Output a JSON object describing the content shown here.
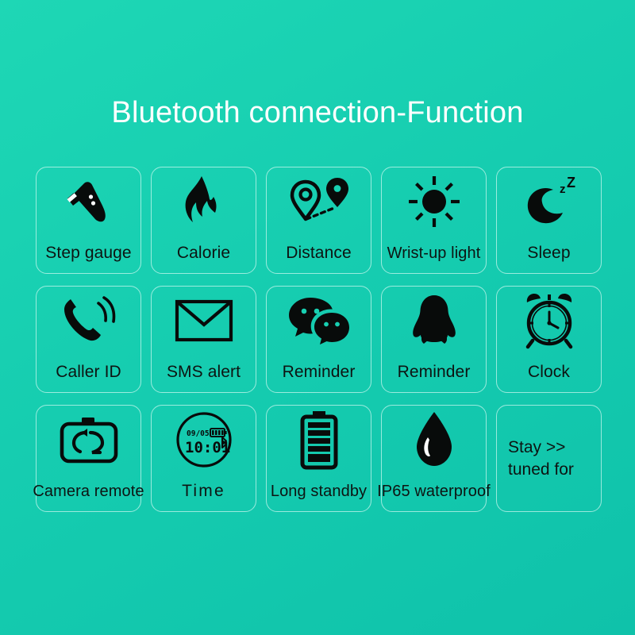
{
  "header": {
    "title": "Bluetooth connection-Function"
  },
  "colors": {
    "background_top": "#1ed7b5",
    "background_bottom": "#0fc2aa",
    "title_text": "#ffffff",
    "label_text": "#0d1412",
    "icon": "#080b0a",
    "card_border": "rgba(235,255,250,0.62)"
  },
  "features": [
    {
      "label": "Step gauge",
      "icon": "shoe-icon"
    },
    {
      "label": "Calorie",
      "icon": "flame-icon"
    },
    {
      "label": "Distance",
      "icon": "map-pins-icon"
    },
    {
      "label": "Wrist-up light",
      "icon": "sun-icon"
    },
    {
      "label": "Sleep",
      "icon": "moon-zz-icon"
    },
    {
      "label": "Caller ID",
      "icon": "ringing-phone-icon"
    },
    {
      "label": "SMS alert",
      "icon": "envelope-icon"
    },
    {
      "label": "Reminder",
      "icon": "wechat-bubbles-icon"
    },
    {
      "label": "Reminder",
      "icon": "qq-penguin-icon"
    },
    {
      "label": "Clock",
      "icon": "alarm-clock-icon"
    },
    {
      "label": "Camera remote",
      "icon": "camera-icon"
    },
    {
      "label": "Time",
      "icon": "watch-face-icon"
    },
    {
      "label": "Long standby",
      "icon": "battery-icon"
    },
    {
      "label": "IP65  waterproof",
      "icon": "water-drop-icon"
    }
  ],
  "watch_face": {
    "date": "09/05",
    "time": "10:01",
    "bluetooth_glyph": "⎄"
  },
  "stay_tuned_tile": {
    "line1": "Stay >>",
    "line2": "tuned for"
  }
}
